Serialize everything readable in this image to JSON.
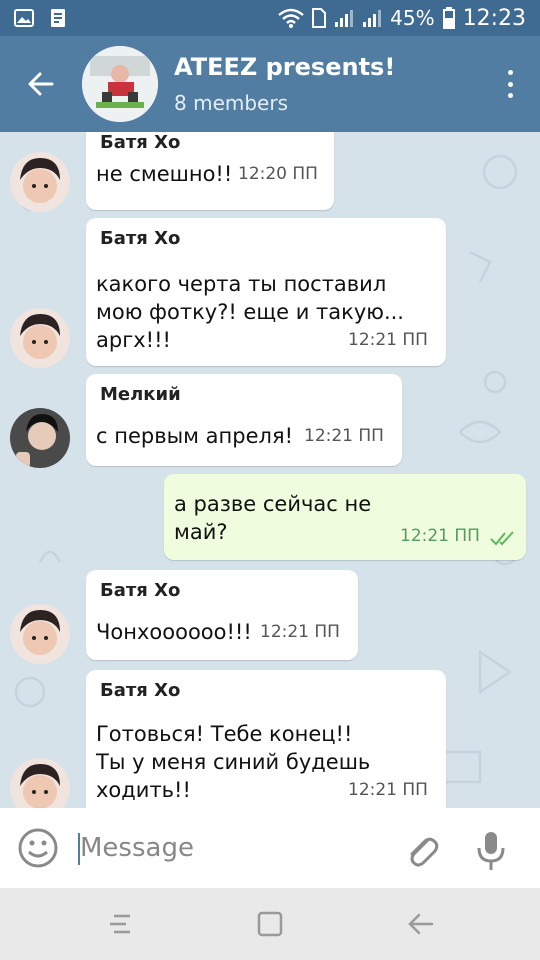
{
  "status_bar": {
    "battery": "45%",
    "time": "12:23"
  },
  "header": {
    "title": "ATEEZ presents!",
    "members": "8 members"
  },
  "messages": [
    {
      "sender": "Батя Хо",
      "text": "не смешно!!",
      "time": "12:20 ПП"
    },
    {
      "sender": "Батя Хо",
      "text_lines": [
        "какого черта ты поставил",
        "мою фотку?! еще и такую...",
        "аргх!!!"
      ],
      "time": "12:21 ПП"
    },
    {
      "sender": "Мелкий",
      "text": "с первым апреля!",
      "time": "12:21 ПП"
    },
    {
      "sender": "",
      "text_lines": [
        "а разве сейчас не",
        "май?"
      ],
      "time": "12:21 ПП",
      "outgoing": true
    },
    {
      "sender": "Батя Хо",
      "text": "Чонхоооооо!!!",
      "time": "12:21 ПП"
    },
    {
      "sender": "Батя Хо",
      "text_lines": [
        "Готовься! Тебе конец!!",
        "Ты у меня синий будешь",
        "ходить!!"
      ],
      "time": "12:21 ПП"
    }
  ],
  "input": {
    "placeholder": "Message"
  },
  "colors": {
    "header": "#517da2",
    "status_bar": "#3f6a91",
    "chat_bg": "#d6e2ea",
    "outgoing_bubble": "#effdde"
  },
  "icons": {
    "back": "arrow-left-icon",
    "menu": "more-vertical-icon",
    "emoji": "smile-icon",
    "attach": "paperclip-icon",
    "mic": "microphone-icon"
  }
}
